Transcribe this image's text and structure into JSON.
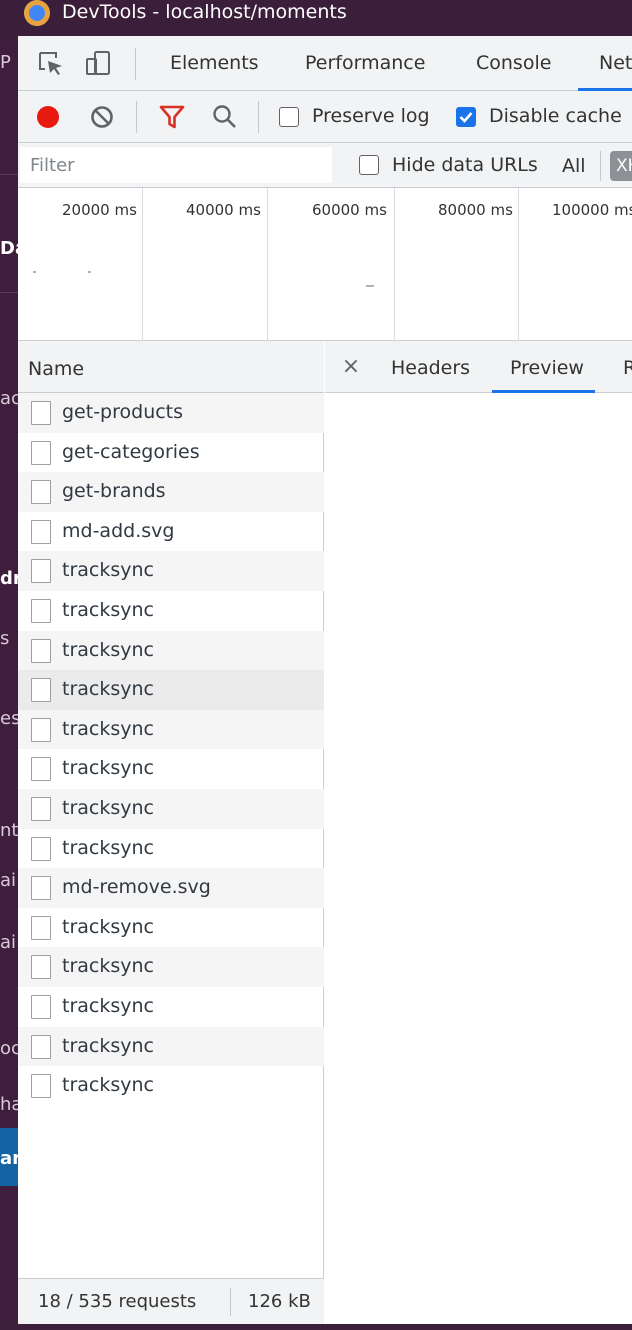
{
  "window": {
    "title": "DevTools - localhost/moments"
  },
  "background_app": {
    "fragments": [
      {
        "text": "P",
        "bold": false
      },
      {
        "text": "Da",
        "bold": true
      },
      {
        "text": "ac",
        "bold": false
      },
      {
        "text": "dr",
        "bold": true
      },
      {
        "text": "s",
        "bold": false
      },
      {
        "text": "es",
        "bold": false
      },
      {
        "text": "nt",
        "bold": false
      },
      {
        "text": "ai",
        "bold": false
      },
      {
        "text": "ai",
        "bold": false
      },
      {
        "text": "oc",
        "bold": false
      },
      {
        "text": "ha",
        "bold": false
      },
      {
        "text": "ar",
        "bold": true
      }
    ]
  },
  "main_tabs": {
    "elements": "Elements",
    "performance": "Performance",
    "console": "Console",
    "network": "Network"
  },
  "network_toolbar": {
    "preserve_log": "Preserve log",
    "preserve_log_checked": false,
    "disable_cache": "Disable cache",
    "disable_cache_checked": true,
    "record_color": "#e8190e",
    "filter_icon_color": "#d93025"
  },
  "filter_row": {
    "filter_placeholder": "Filter",
    "hide_data_urls": "Hide data URLs",
    "hide_data_urls_checked": false,
    "all": "All",
    "xhr": "XHR"
  },
  "overview": {
    "ticks": [
      "20000 ms",
      "40000 ms",
      "60000 ms",
      "80000 ms",
      "100000 ms"
    ]
  },
  "requests": {
    "header_name": "Name",
    "rows": [
      {
        "name": "get-products"
      },
      {
        "name": "get-categories"
      },
      {
        "name": "get-brands"
      },
      {
        "name": "md-add.svg"
      },
      {
        "name": "tracksync"
      },
      {
        "name": "tracksync"
      },
      {
        "name": "tracksync"
      },
      {
        "name": "tracksync",
        "hover": true
      },
      {
        "name": "tracksync"
      },
      {
        "name": "tracksync"
      },
      {
        "name": "tracksync"
      },
      {
        "name": "tracksync"
      },
      {
        "name": "md-remove.svg"
      },
      {
        "name": "tracksync"
      },
      {
        "name": "tracksync"
      },
      {
        "name": "tracksync"
      },
      {
        "name": "tracksync"
      },
      {
        "name": "tracksync"
      }
    ],
    "status_requests": "18 / 535 requests",
    "status_size": "126 kB"
  },
  "detail": {
    "close": "×",
    "tabs": [
      "Headers",
      "Preview",
      "Response"
    ],
    "active_tab": "Preview"
  },
  "colors": {
    "accent": "#1a73e8",
    "toolbar_bg": "#f1f3f4",
    "slack_sidebar": "#3f1d3d"
  }
}
